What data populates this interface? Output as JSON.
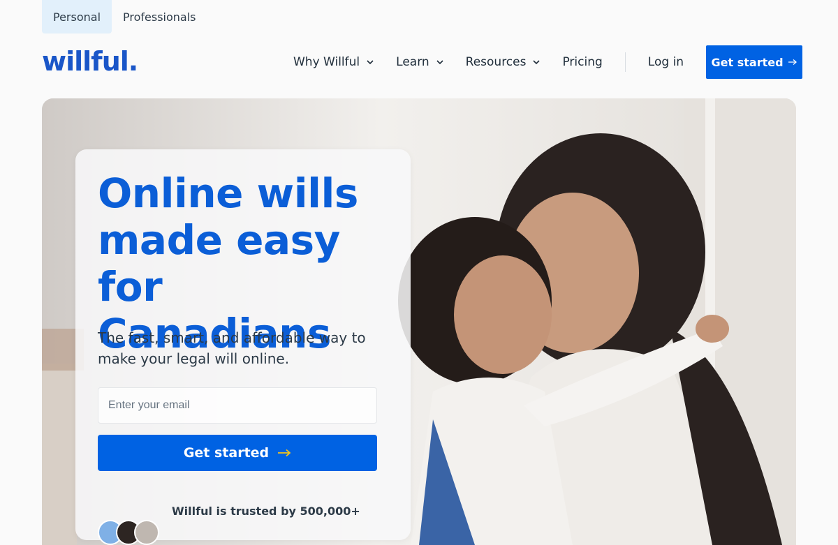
{
  "audience_tabs": [
    {
      "label": "Personal",
      "active": true
    },
    {
      "label": "Professionals",
      "active": false
    }
  ],
  "brand": {
    "logo_text": "willful.",
    "accent": "#0062e3",
    "headline_color": "#0b5ed7"
  },
  "nav": {
    "items": [
      {
        "label": "Why Willful",
        "has_dropdown": true
      },
      {
        "label": "Learn",
        "has_dropdown": true
      },
      {
        "label": "Resources",
        "has_dropdown": true
      },
      {
        "label": "Pricing",
        "has_dropdown": false
      }
    ],
    "login_label": "Log in",
    "cta_label": "Get started",
    "cta_icon": "arrow-right-icon"
  },
  "hero": {
    "headline_lines": [
      "Online wills",
      "made easy for",
      "Canadians"
    ],
    "subtext": "The fast, smart, and affordable way to make your legal will online.",
    "email_placeholder": "Enter your email",
    "cta_label": "Get started",
    "cta_icon": "arrow-right-icon",
    "trust_text": "Willful is trusted by 500,000+"
  }
}
